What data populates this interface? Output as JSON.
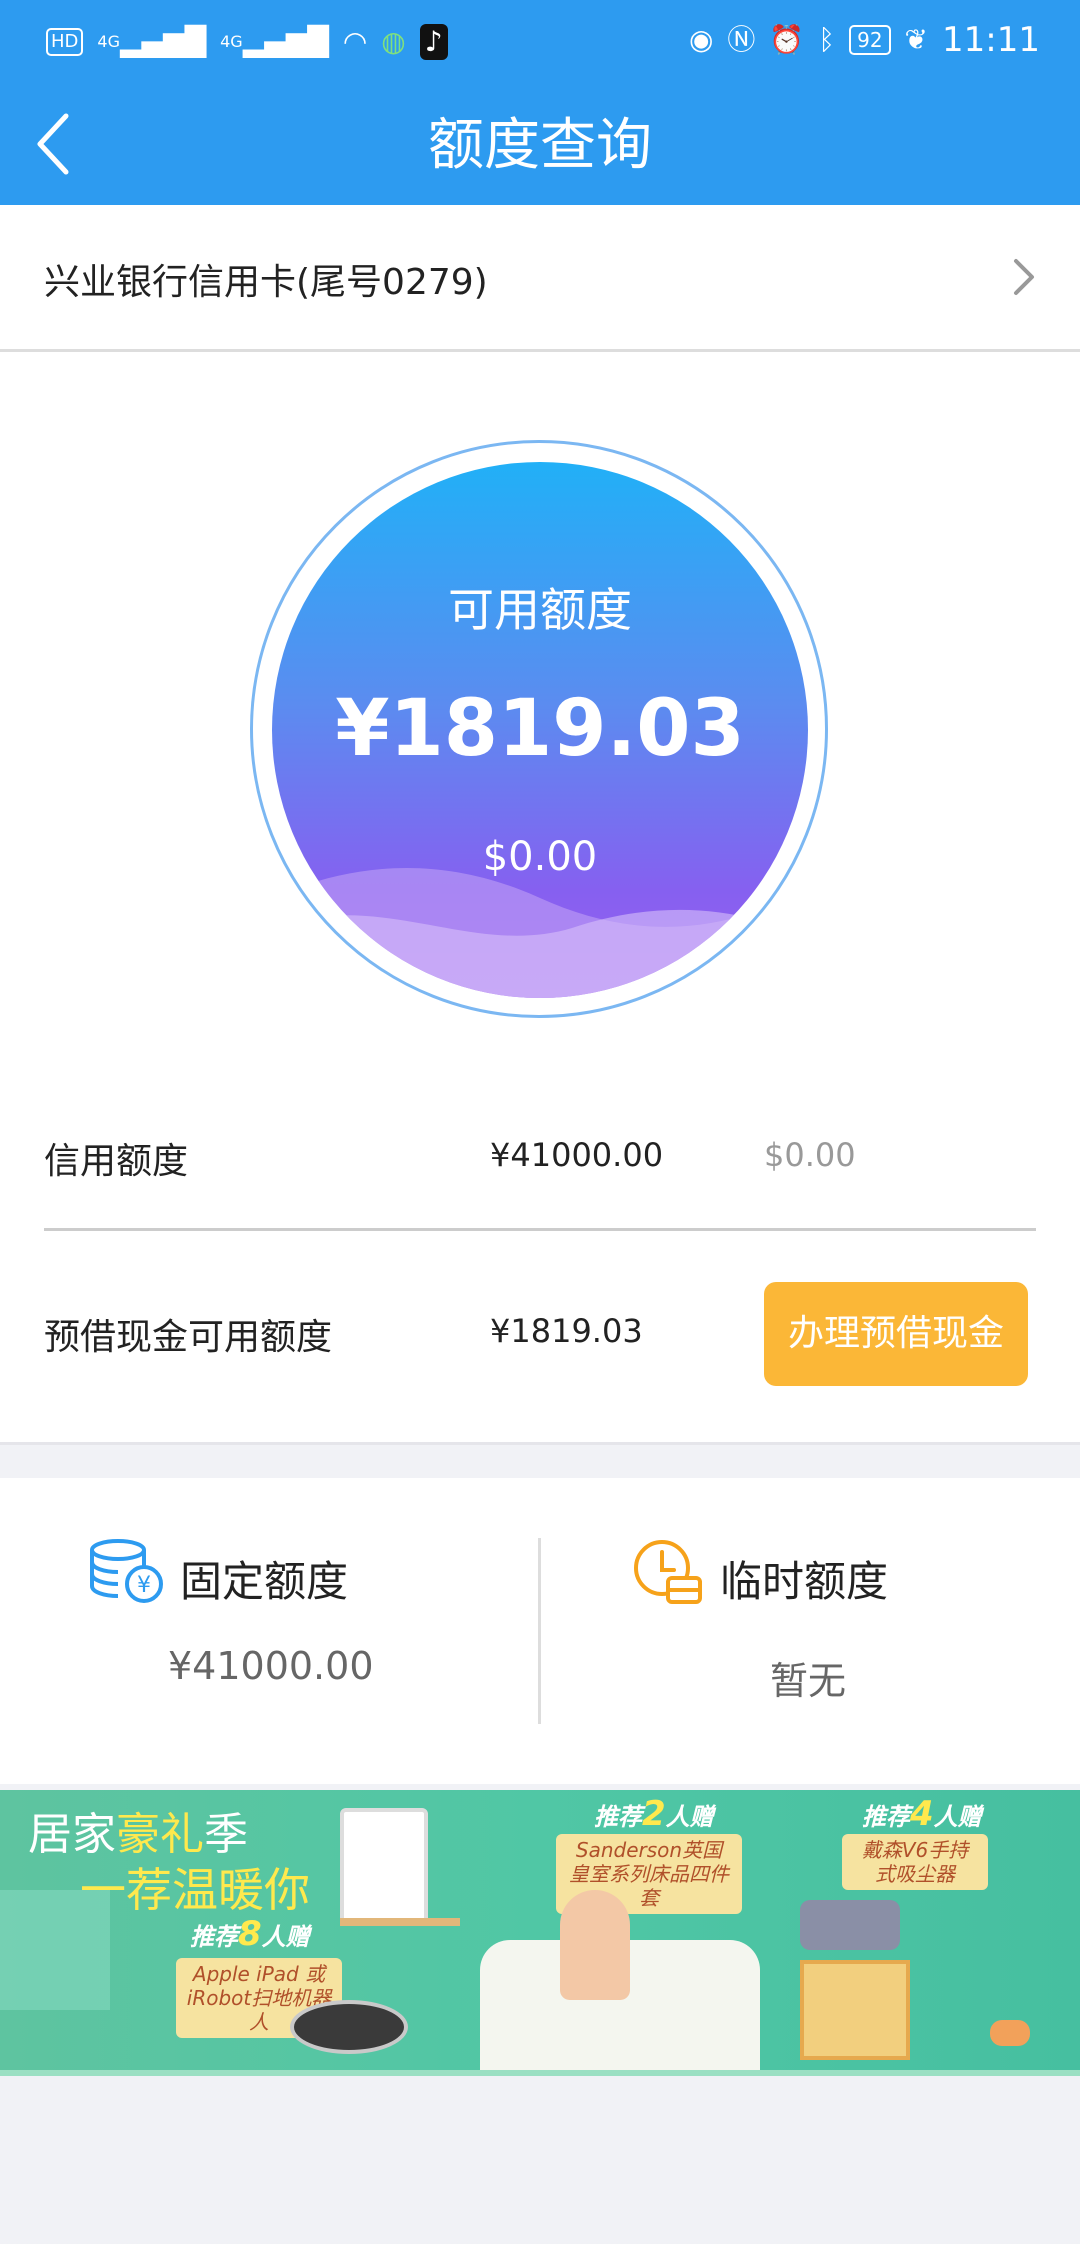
{
  "status_bar": {
    "hd": "HD",
    "net1": "4G",
    "net2": "4G",
    "battery": "92",
    "time": "11:11"
  },
  "header": {
    "title": "额度查询"
  },
  "card": {
    "name": "兴业银行信用卡(尾号0279)"
  },
  "available": {
    "label": "可用额度",
    "amount": "¥1819.03",
    "usd": "$0.00"
  },
  "credit_limit": {
    "label": "信用额度",
    "value": "¥41000.00",
    "usd": "$0.00"
  },
  "cash_advance": {
    "label": "预借现金可用额度",
    "value": "¥1819.03",
    "button": "办理预借现金"
  },
  "limits": {
    "fixed_label": "固定额度",
    "fixed_value": "¥41000.00",
    "temp_label": "临时额度",
    "temp_value": "暂无"
  },
  "banner": {
    "line1_a": "居家",
    "line1_b": "豪礼",
    "line1_c": "季",
    "line2": "一荐温暖你",
    "promo8_a": "推荐",
    "promo8_n": "8",
    "promo8_b": "人赠",
    "promo8_prize": "Apple iPad 或 iRobot扫地机器人",
    "promo2_a": "推荐",
    "promo2_n": "2",
    "promo2_b": "人赠",
    "promo2_prize": "Sanderson英国 皇室系列床品四件套",
    "promo4_a": "推荐",
    "promo4_n": "4",
    "promo4_b": "人赠",
    "promo4_prize": "戴森V6手持 式吸尘器"
  },
  "colors": {
    "header": "#2d9bf0",
    "button": "#fbb737",
    "fixed_icon": "#2d9bf0",
    "temp_icon": "#f6a21a"
  }
}
